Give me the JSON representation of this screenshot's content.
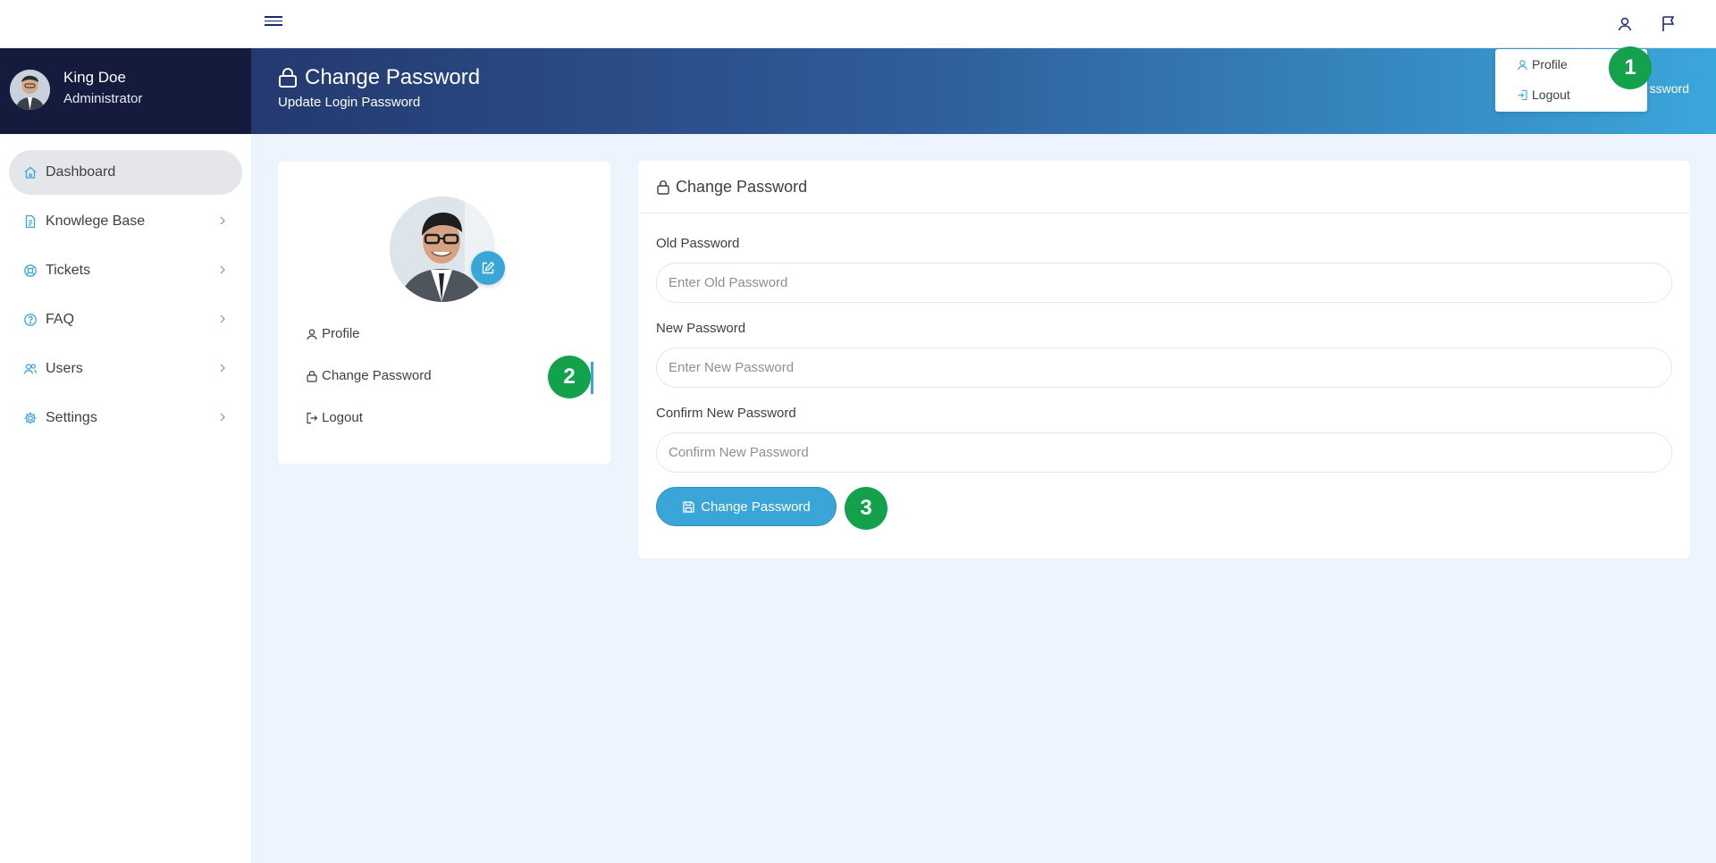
{
  "sidebar": {
    "user": {
      "name": "King Doe",
      "role": "Administrator"
    },
    "items": [
      {
        "label": "Dashboard",
        "icon": "home-icon",
        "active": true
      },
      {
        "label": "Knowlege Base",
        "icon": "document-icon"
      },
      {
        "label": "Tickets",
        "icon": "lifebuoy-icon"
      },
      {
        "label": "FAQ",
        "icon": "help-circle-icon"
      },
      {
        "label": "Users",
        "icon": "users-icon"
      },
      {
        "label": "Settings",
        "icon": "gear-icon"
      }
    ]
  },
  "topbar": {
    "icons": [
      "menu-icon",
      "user-icon",
      "flag-icon"
    ]
  },
  "header": {
    "title": "Change Password",
    "subtitle": "Update Login Password",
    "breadcrumb": "ssword"
  },
  "user_dropdown": {
    "profile": "Profile",
    "logout": "Logout"
  },
  "markers": {
    "one": "1",
    "two": "2",
    "three": "3"
  },
  "profile_menu": {
    "profile": "Profile",
    "change_password": "Change Password",
    "logout": "Logout"
  },
  "form": {
    "title": "Change Password",
    "old_label": "Old Password",
    "old_placeholder": "Enter Old Password",
    "new_label": "New Password",
    "new_placeholder": "Enter New Password",
    "confirm_label": "Confirm New Password",
    "confirm_placeholder": "Confirm New Password",
    "submit_label": "Change Password"
  },
  "colors": {
    "sidebar_head": "#141b3c",
    "accent": "#3aa6d8",
    "marker": "#14a14c",
    "background": "#edf4fd"
  }
}
